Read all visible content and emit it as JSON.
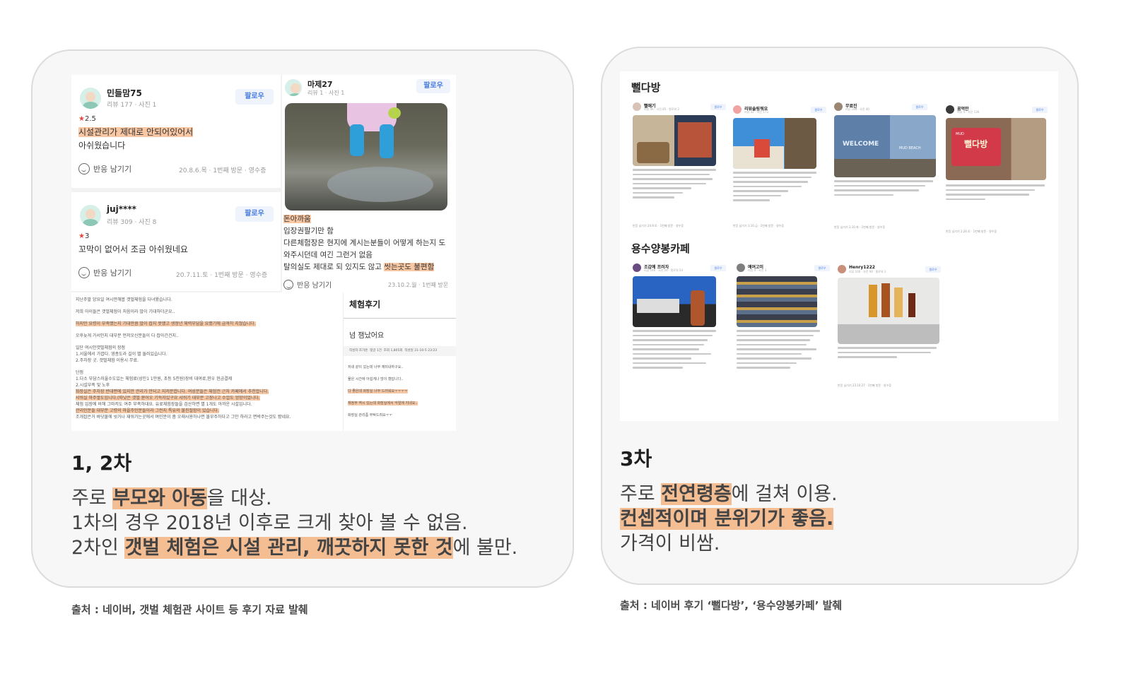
{
  "left": {
    "heading": "1, 2차",
    "desc": {
      "l1_a": "주로 ",
      "l1_hl": "부모와 아동",
      "l1_b": "을 대상.",
      "l2": "1차의 경우 2018년 이후로 크게 찾아 볼 수 없음.",
      "l3_a": "2차인 ",
      "l3_hl": "갯벌 체험은 시설 관리, 깨끗하지 못한 것",
      "l3_b": "에 불만."
    },
    "source": "출처 : 네이버, 갯벌 체험관 사이트 등 후기 자료 발췌",
    "reviews": [
      {
        "name": "민들맘75",
        "meta": "리뷰 177 · 사진 1",
        "follow": "팔로우",
        "rating": "2.5",
        "text_hl": "시설관리가 제대로 안되어있어서",
        "text": "아쉬웠습니다",
        "react": "반응 남기기",
        "visit": "20.8.6.목 · 1번째 방문 · 영수증"
      },
      {
        "name": "juj****",
        "meta": "리뷰 309 · 사진 8",
        "follow": "팔로우",
        "rating": "3",
        "text": "꼬막이 없어서 조금 아쉬웠네요",
        "react": "반응 남기기",
        "visit": "20.7.11.토 · 1번째 방문 · 영수증"
      },
      {
        "name": "마제27",
        "meta": "리뷰 1 · 사진 1",
        "follow": "팔로우",
        "text_hl": "돈아까움",
        "t2": "입장권팔기만 함",
        "t3": "다른체험장은 현지에 계시는분들이 어떻게 하는지 도",
        "t4": "와주시던데 여긴 그런거 없음",
        "t5_a": "탈의실도 제대로 되 있지도 않고 ",
        "t5_hl": "씻는곳도 불편함",
        "react": "반응 남기기",
        "visit": "23.10.2.월 · 1번째 방문"
      }
    ],
    "blog_lines": [
      "지난주말 앙요일 여시만해봅 갯벌체험을 다녀왔습니다.",
      "저희 아이들은 갯벌체험이 처음이라 많이 기대하더군요..",
      "하지만 요령이 부족했는지 기대만큼 많이 잡지 못했고 생정년 체력부담을 요했기에 급격히 지쳤습니다.",
      "오후늦게 가서인지 대부분 먼저오신분들이 다 잡아간건지..",
      "일단 여시안갯벌체험의 장점",
      "1.서울에서 가깝다. 영종도라 길이 별 둘러있습니다.",
      "2.주차장 굿. 갯벌체험 이용시 무료.",
      "단점",
      "1.다소 부담스러울수도있는 체험료(성인1 1만원, 초등 5천원)장비 대여료,현우 현금결제",
      "2.시설부족 및 노후",
      "화장실은 주차장 반대편에 있지만 관리가 안되고 지저분합니다. 여성분들은 체험전 근처 카페에서 추천합니다.",
      "샤워실 마주쌓도입니다.(따낫은 갯벌 묻어오 기득자있구요 샤워기 대부분 고장나고 수압도 엉망이었니다.",
      "체험 입장에 비해 그마저도 여주 부족하대요. 유료체험장들을 검산하면 별 1개도 아까운 시설입니다.",
      "관리인분들 대부분 고령의 마을주민분들이라 그런지 특유의 불친절함이 있습니다.",
      "조개잡은거 바닷물에 씻거나 재워가는곳에서 며민분이 좀 오래사용하나면 불부주하다고 그만 하라고 면박주는것도 봤네요."
    ],
    "exp": {
      "title": "체험후기",
      "subtitle": "넘 잼났어요",
      "tabs": [
        "작성자 조가온",
        "댓글 1건",
        "조회 1,805회",
        "작성일 21-10-5 23:23"
      ],
      "lines": [
        "저네 같이 갔는데 너무 재미내하구요..",
        "물은 시간에 아쉽게나 많이 했답니다..",
        "다 좋은데 화장실 너무 드러워요ㅜㅜㅜㅜ",
        "재정부 역시 있는데 화장실에서 악얼에 지네요..",
        "화장실 관리좀 부탁드려요ㅜㅜ"
      ]
    }
  },
  "right": {
    "heading": "3차",
    "desc": {
      "l1_a": "주로 ",
      "l1_hl": "전연령층",
      "l1_b": "에 걸쳐 이용.",
      "l2_hl": "컨셉적이며 분위기가 좋음.",
      "l3": "가격이 비쌈."
    },
    "source": "출처 : 네이버 후기 ‘뻘다방’, ‘용수양봉카페’ 발췌",
    "sections": [
      {
        "title": "뻘다방",
        "cards": [
          {
            "name": "뻘애기",
            "meta": "리뷰 46 · 사진 85 · 팔로워 2",
            "follow": "팔로우",
            "foot": "반응 남기기   24.9.토 · 1번째 방문 · 영수증"
          },
          {
            "name": "리뷰솔링워요",
            "meta": "리뷰 32 · 사진 173",
            "follow": "팔로우",
            "foot": "반응 남기기   3.10.금 · 1번째 방문 · 영수증"
          },
          {
            "name": "무료진",
            "meta": "리뷰 198 · 사진 40",
            "follow": "팔로우",
            "foot": "반응 남기기   3.10.화 · 1번째 방문 · 영수증"
          },
          {
            "name": "꿈먹만",
            "meta": "리뷰 4 · 사진 136",
            "follow": "팔로우",
            "foot": "반응 남기기   2.24.토 · 1번째 방문 · 영수증"
          }
        ],
        "photo_text": [
          "WELCOME",
          "MUD BEACH",
          "MUD",
          "뻘다방"
        ]
      },
      {
        "title": "용수양봉카페",
        "cards": [
          {
            "name": "조갑예 프러자",
            "meta": "리뷰 146 · 사진 24 · 팔로워 54",
            "follow": "팔로우",
            "foot": ""
          },
          {
            "name": "예여고미",
            "meta": "리뷰 4 · 사진 3",
            "follow": "팔로우",
            "foot": ""
          },
          {
            "name": "Henry1222",
            "meta": "리뷰 100 · 사진 94 · 팔로워 3",
            "follow": "팔로우",
            "foot": "반응 남기기   23.10.27 · 1번째 방문 · 영수증"
          }
        ]
      }
    ]
  },
  "colors": {
    "panel_bg": "#f7f7f7",
    "panel_border": "#dcdcdc",
    "highlight": "#f8c7a3",
    "follow_text": "#4a7de0",
    "star": "#e24a3b"
  }
}
